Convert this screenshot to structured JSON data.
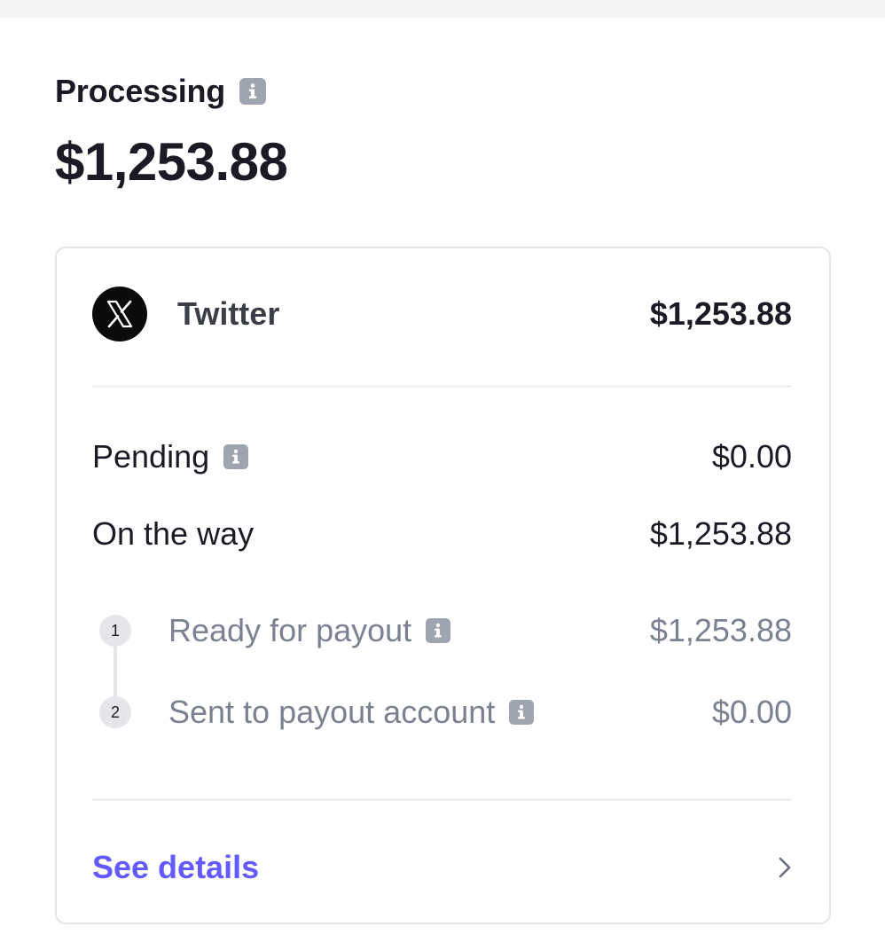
{
  "header": {
    "label": "Processing",
    "total": "$1,253.88"
  },
  "source": {
    "icon": "x-logo-icon",
    "name": "Twitter",
    "amount": "$1,253.88"
  },
  "rows": {
    "pending": {
      "label": "Pending",
      "value": "$0.00"
    },
    "on_the_way": {
      "label": "On the way",
      "value": "$1,253.88"
    }
  },
  "steps": [
    {
      "number": "1",
      "label": "Ready for payout",
      "value": "$1,253.88"
    },
    {
      "number": "2",
      "label": "Sent to payout account",
      "value": "$0.00"
    }
  ],
  "footer": {
    "see_details": "See details",
    "chevron_icon": "chevron-right-icon"
  },
  "colors": {
    "link": "#635bff",
    "text": "#1a1b25",
    "muted": "#7b8190",
    "info_icon": "#9ea5b1"
  }
}
